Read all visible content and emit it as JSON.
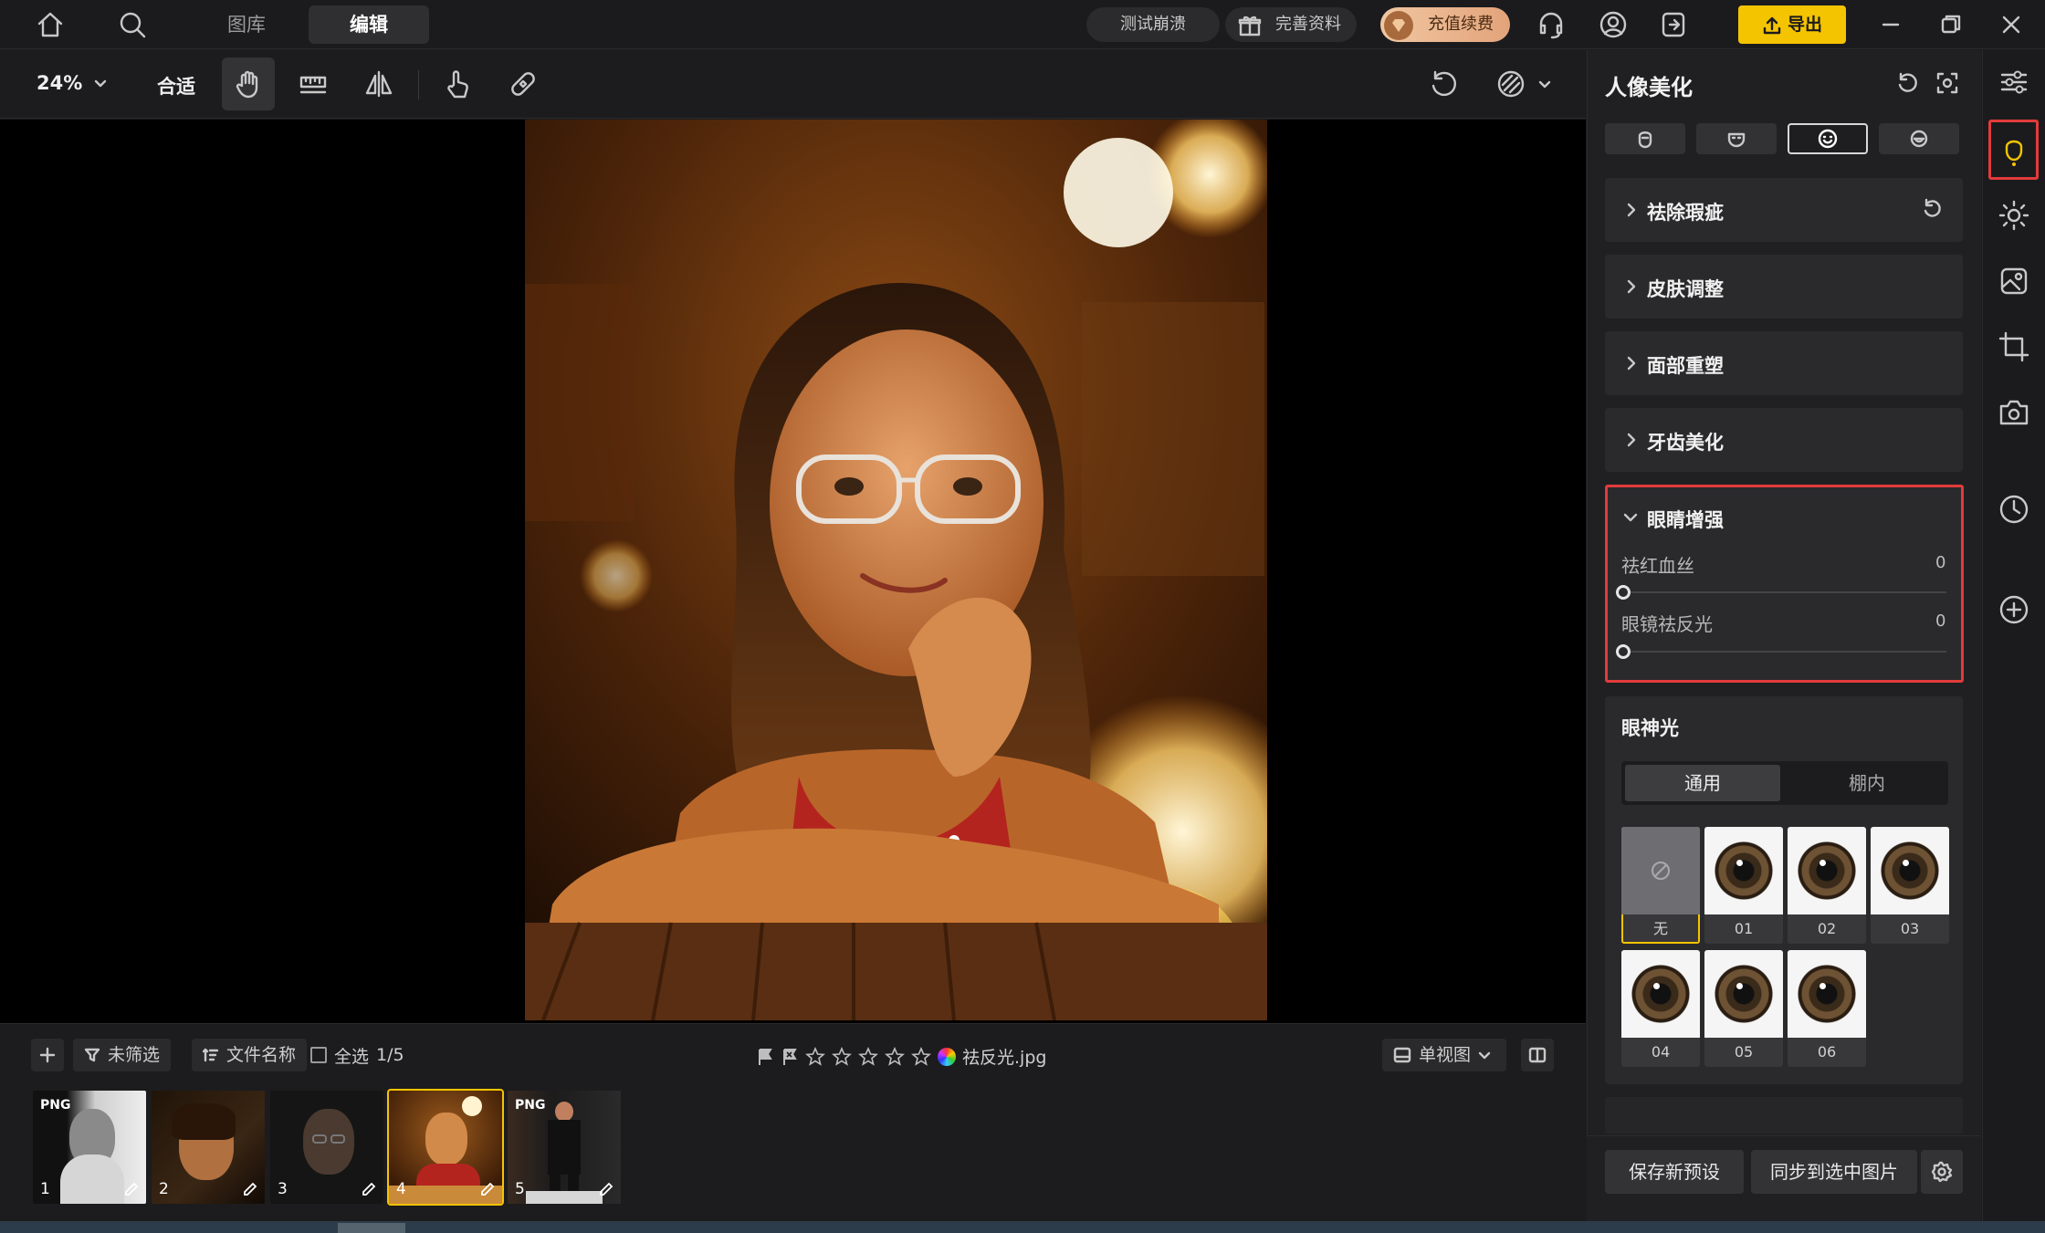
{
  "topbar": {
    "tabs": [
      {
        "label": "图库"
      },
      {
        "label": "编辑"
      }
    ],
    "pills": {
      "test": "测试崩溃",
      "profile": "完善资料",
      "recharge": "充值续费"
    },
    "export_label": "导出"
  },
  "toolbar": {
    "zoom": "24%",
    "fit_label": "合适"
  },
  "filterbar": {
    "filter_label": "未筛选",
    "sort_label": "文件名称",
    "select_all_label": "全选",
    "count": "1/5",
    "filename": "祛反光.jpg",
    "view_label": "单视图"
  },
  "thumbnails": [
    {
      "num": "1",
      "badge": "PNG"
    },
    {
      "num": "2",
      "badge": ""
    },
    {
      "num": "3",
      "badge": ""
    },
    {
      "num": "4",
      "badge": "",
      "selected": true
    },
    {
      "num": "5",
      "badge": "PNG"
    }
  ],
  "panel": {
    "title": "人像美化",
    "sections": [
      {
        "label": "祛除瑕疵"
      },
      {
        "label": "皮肤调整"
      },
      {
        "label": "面部重塑"
      },
      {
        "label": "牙齿美化"
      }
    ],
    "eye_section": {
      "label": "眼睛增强",
      "sliders": [
        {
          "label": "祛红血丝",
          "value": "0"
        },
        {
          "label": "眼镜祛反光",
          "value": "0"
        }
      ]
    },
    "glint": {
      "title": "眼神光",
      "segments": [
        {
          "label": "通用"
        },
        {
          "label": "棚内"
        }
      ],
      "swatches": [
        {
          "label": "无",
          "type": "none"
        },
        {
          "label": "01"
        },
        {
          "label": "02"
        },
        {
          "label": "03"
        },
        {
          "label": "04"
        },
        {
          "label": "05"
        },
        {
          "label": "06"
        }
      ]
    },
    "footer": {
      "save_preset": "保存新预设",
      "sync": "同步到选中图片"
    }
  },
  "colors": {
    "accent": "#f5c400",
    "highlight_box": "#e23b3b"
  }
}
